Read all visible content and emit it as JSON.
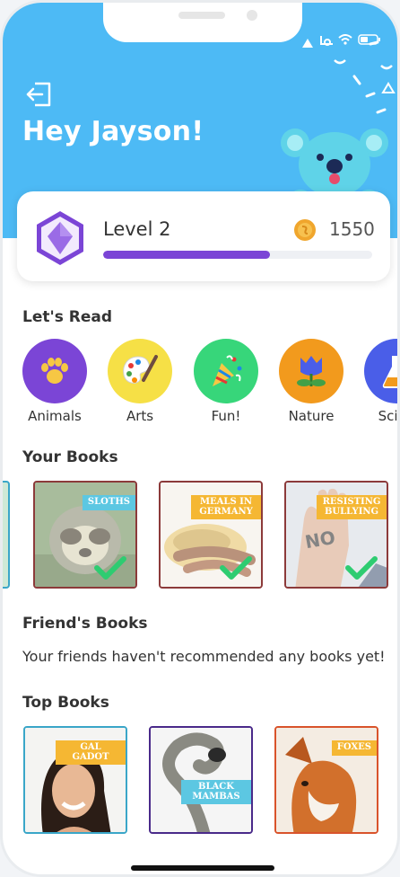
{
  "header": {
    "greeting": "Hey Jayson!"
  },
  "level_card": {
    "level_label": "Level 2",
    "coins": "1550",
    "progress_fraction": 0.62
  },
  "sections": {
    "lets_read": "Let's Read",
    "your_books": "Your Books",
    "friends_books": "Friend's Books",
    "top_books": "Top Books"
  },
  "categories": [
    {
      "label": "Animals",
      "color": "#7b45d6"
    },
    {
      "label": "Arts",
      "color": "#f6e046"
    },
    {
      "label": "Fun!",
      "color": "#37d67a"
    },
    {
      "label": "Nature",
      "color": "#f29a1d"
    },
    {
      "label": "Scien",
      "color": "#4a5ee8"
    }
  ],
  "your_books": [
    {
      "title": "SLOTHS",
      "completed": true
    },
    {
      "title": "MEALS IN GERMANY",
      "completed": true
    },
    {
      "title": "RESISTING BULLYING",
      "completed": true
    }
  ],
  "friends_books": {
    "empty_message": "Your friends haven't recommended any books yet!"
  },
  "top_books": [
    {
      "title": "GAL GADOT"
    },
    {
      "title": "BLACK MAMBAS"
    },
    {
      "title": "FOXES"
    }
  ]
}
